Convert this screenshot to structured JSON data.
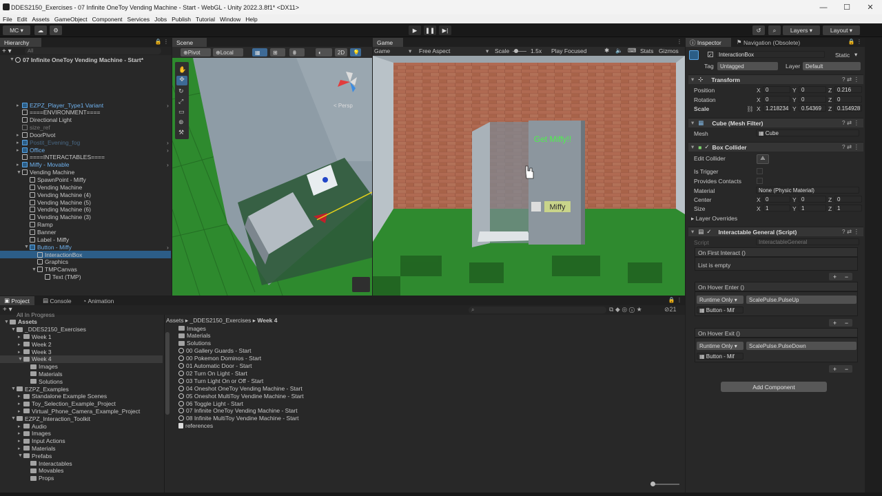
{
  "window": {
    "title": "DDES2150_Exercises - 07 Infinite OneToy Vending Machine - Start - WebGL - Unity 2022.3.8f1* <DX11>",
    "controls": [
      "—",
      "☐",
      "✕"
    ]
  },
  "menu": [
    "File",
    "Edit",
    "Assets",
    "GameObject",
    "Component",
    "Services",
    "Jobs",
    "Publish",
    "Tutorial",
    "Window",
    "Help"
  ],
  "toolbar": {
    "account": "MC ▾",
    "layers": "Layers",
    "layout": "Layout"
  },
  "hierarchy": {
    "tab": "Hierarchy",
    "search_placeholder": "All",
    "scene": "07 Infinite OneToy Vending Machine - Start*",
    "items": [
      {
        "label": "EZPZ_Player_Type1 Variant",
        "style": "blue",
        "indent": 1
      },
      {
        "label": "====ENVIRONMENT====",
        "style": "normal",
        "indent": 1
      },
      {
        "label": "Directional Light",
        "style": "normal",
        "indent": 1
      },
      {
        "label": "size_ref",
        "style": "dim",
        "indent": 1
      },
      {
        "label": "DoorPivot",
        "style": "normal",
        "indent": 1
      },
      {
        "label": "Postit_Evening_fog",
        "style": "dimblue",
        "indent": 1
      },
      {
        "label": "Office",
        "style": "blue",
        "indent": 1
      },
      {
        "label": "====INTERACTABLES====",
        "style": "normal",
        "indent": 1
      },
      {
        "label": "Miffy - Movable",
        "style": "blue",
        "indent": 1
      },
      {
        "label": "Vending Machine",
        "style": "normal",
        "indent": 1
      },
      {
        "label": "SpawnPoint - Miffy",
        "style": "normal",
        "indent": 2
      },
      {
        "label": "Vending Machine",
        "style": "normal",
        "indent": 2
      },
      {
        "label": "Vending Machine (4)",
        "style": "normal",
        "indent": 2
      },
      {
        "label": "Vending Machine (5)",
        "style": "normal",
        "indent": 2
      },
      {
        "label": "Vending Machine (6)",
        "style": "normal",
        "indent": 2
      },
      {
        "label": "Vending Machine (3)",
        "style": "normal",
        "indent": 2
      },
      {
        "label": "Ramp",
        "style": "normal",
        "indent": 2
      },
      {
        "label": "Banner",
        "style": "normal",
        "indent": 2
      },
      {
        "label": "Label - Miffy",
        "style": "normal",
        "indent": 2
      },
      {
        "label": "Button - Miffy",
        "style": "blue",
        "indent": 2
      },
      {
        "label": "InteractionBox",
        "style": "selected",
        "indent": 3
      },
      {
        "label": "Graphics",
        "style": "normal",
        "indent": 3
      },
      {
        "label": "TMPCanvas",
        "style": "normal",
        "indent": 3
      },
      {
        "label": "Text (TMP)",
        "style": "normal",
        "indent": 4
      }
    ]
  },
  "scene": {
    "tab": "Scene",
    "pivot": "Pivot",
    "local": "Local",
    "mode2d": "2D",
    "persp": "< Persp"
  },
  "game": {
    "tab": "Game",
    "display": "Game",
    "aspect": "Free Aspect",
    "scale_label": "Scale",
    "scale_value": "1.5x",
    "play_focused": "Play Focused",
    "stats": "Stats",
    "gizmos": "Gizmos",
    "banner_text": "Get Miffy!!",
    "button_text": "Miffy"
  },
  "inspector": {
    "tabs": [
      "Inspector",
      "Navigation (Obsolete)"
    ],
    "object_name": "InteractionBox",
    "static_label": "Static",
    "tag_label": "Tag",
    "tag_value": "Untagged",
    "layer_label": "Layer",
    "layer_value": "Default",
    "transform": {
      "title": "Transform",
      "position_label": "Position",
      "rotation_label": "Rotation",
      "scale_label": "Scale",
      "position": [
        "0",
        "0",
        "0.216"
      ],
      "rotation": [
        "0",
        "0",
        "0"
      ],
      "scale": [
        "1.218234",
        "0.54369",
        "0.154928"
      ]
    },
    "mesh_filter": {
      "title": "Cube (Mesh Filter)",
      "mesh_label": "Mesh",
      "mesh_value": "Cube"
    },
    "box_collider": {
      "title": "Box Collider",
      "edit_collider": "Edit Collider",
      "is_trigger": "Is Trigger",
      "provides_contacts": "Provides Contacts",
      "material_label": "Material",
      "material_value": "None (Physic Material)",
      "center_label": "Center",
      "center": [
        "0",
        "0",
        "0"
      ],
      "size_label": "Size",
      "size": [
        "1",
        "1",
        "1"
      ],
      "layer_overrides": "Layer Overrides"
    },
    "interactable": {
      "title": "Interactable General (Script)",
      "script_label": "Script",
      "script_value": "InteractableGeneral",
      "on_first_interact": "On First Interact ()",
      "list_empty": "List is empty",
      "on_hover_enter": "On Hover Enter ()",
      "on_hover_exit": "On Hover Exit ()",
      "runtime_only": "Runtime Only",
      "pulse_up": "ScalePulse.PulseUp",
      "pulse_down": "ScalePulse.PulseDown",
      "target": "Button - Mif"
    },
    "add_component": "Add Component"
  },
  "project": {
    "tabs": [
      "Project",
      "Console",
      "Animation"
    ],
    "count": "21",
    "breadcrumb": [
      "Assets",
      "_DDES2150_Exercises",
      "Week 4"
    ],
    "tree": [
      {
        "label": "All In Progress",
        "indent": 1
      },
      {
        "label": "Assets",
        "indent": 0,
        "bold": true
      },
      {
        "label": "_DDES2150_Exercises",
        "indent": 1
      },
      {
        "label": "Week 1",
        "indent": 2
      },
      {
        "label": "Week 2",
        "indent": 2
      },
      {
        "label": "Week 3",
        "indent": 2
      },
      {
        "label": "Week 4",
        "indent": 2
      },
      {
        "label": "Images",
        "indent": 3
      },
      {
        "label": "Materials",
        "indent": 3
      },
      {
        "label": "Solutions",
        "indent": 3
      },
      {
        "label": "EZPZ_Examples",
        "indent": 1
      },
      {
        "label": "Standalone Example Scenes",
        "indent": 2
      },
      {
        "label": "Toy_Selection_Example_Project",
        "indent": 2
      },
      {
        "label": "Virtual_Phone_Camera_Example_Project",
        "indent": 2
      },
      {
        "label": "EZPZ_Interaction_Toolkit",
        "indent": 1
      },
      {
        "label": "Audio",
        "indent": 2
      },
      {
        "label": "Images",
        "indent": 2
      },
      {
        "label": "Input Actions",
        "indent": 2
      },
      {
        "label": "Materials",
        "indent": 2
      },
      {
        "label": "Prefabs",
        "indent": 2
      },
      {
        "label": "Interactables",
        "indent": 3
      },
      {
        "label": "Movables",
        "indent": 3
      },
      {
        "label": "Props",
        "indent": 3
      }
    ],
    "files": [
      {
        "label": "Images",
        "kind": "folder"
      },
      {
        "label": "Materials",
        "kind": "folder"
      },
      {
        "label": "Solutions",
        "kind": "folder"
      },
      {
        "label": "00 Gallery Guards - Start",
        "kind": "scene"
      },
      {
        "label": "00 Pokemon Dominos - Start",
        "kind": "scene"
      },
      {
        "label": "01 Automatic Door - Start",
        "kind": "scene"
      },
      {
        "label": "02 Turn On Light - Start",
        "kind": "scene"
      },
      {
        "label": "03 Turn Light On or Off - Start",
        "kind": "scene"
      },
      {
        "label": "04 Oneshot OneToy Vending Machine - Start",
        "kind": "scene"
      },
      {
        "label": "05 Oneshot MultiToy Vendine Machine - Start",
        "kind": "scene"
      },
      {
        "label": "06 Toggle Light - Start",
        "kind": "scene"
      },
      {
        "label": "07 Infinite OneToy Vending Machine - Start",
        "kind": "scene"
      },
      {
        "label": "08 Infinite MultiToy Vendine Machine - Start",
        "kind": "scene"
      },
      {
        "label": "references",
        "kind": "doc"
      }
    ]
  }
}
